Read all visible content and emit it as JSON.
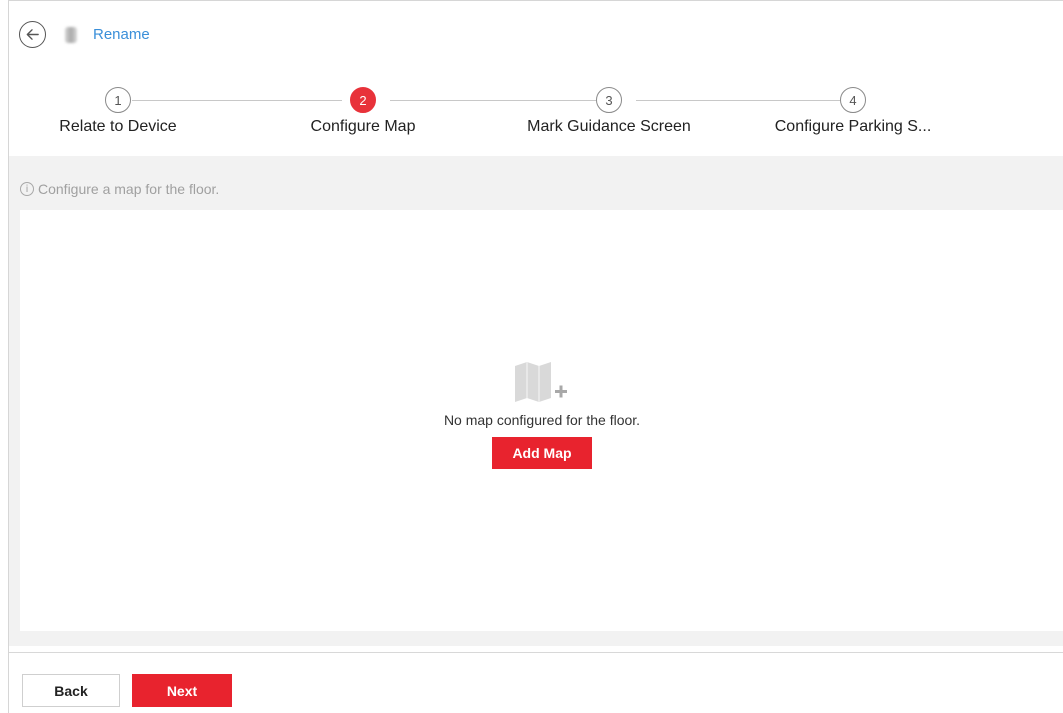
{
  "header": {
    "back_icon": "arrow-left-circle-icon",
    "rename_label": "Rename"
  },
  "stepper": {
    "steps": [
      {
        "number": "1",
        "label": "Relate to Device",
        "active": false
      },
      {
        "number": "2",
        "label": "Configure Map",
        "active": true
      },
      {
        "number": "3",
        "label": "Mark Guidance Screen",
        "active": false
      },
      {
        "number": "4",
        "label": "Configure Parking S...",
        "active": false
      }
    ]
  },
  "content": {
    "hint_icon": "info-icon",
    "hint_glyph": "i",
    "hint_text": "Configure a map for the floor.",
    "empty_icon": "map-add-icon",
    "empty_text": "No map configured for the floor.",
    "add_map_label": "Add Map"
  },
  "footer": {
    "back_label": "Back",
    "next_label": "Next"
  },
  "colors": {
    "accent": "#e8232e",
    "link": "#3a8fd9",
    "panel_bg": "#f2f2f2"
  }
}
